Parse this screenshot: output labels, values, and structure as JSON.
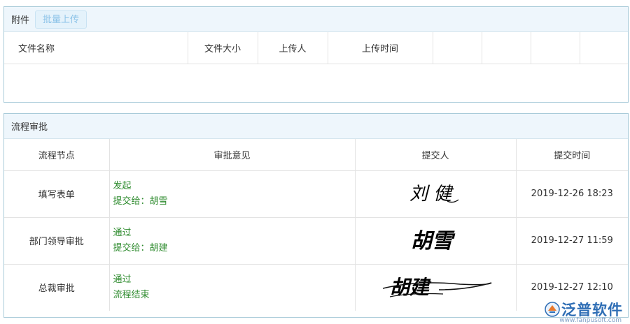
{
  "attachments": {
    "title": "附件",
    "batch_upload_label": "批量上传",
    "columns": [
      "文件名称",
      "文件大小",
      "上传人",
      "上传时间",
      "",
      "",
      "",
      ""
    ]
  },
  "flow": {
    "title": "流程审批",
    "columns": [
      "流程节点",
      "审批意见",
      "提交人",
      "提交时间"
    ],
    "rows": [
      {
        "node": "填写表单",
        "opinion_1": "发起",
        "opinion_2": "提交给：胡雪",
        "signature": "刘 健",
        "time": "2019-12-26 18:23"
      },
      {
        "node": "部门领导审批",
        "opinion_1": "通过",
        "opinion_2": "提交给：胡建",
        "signature": "胡雪",
        "time": "2019-12-27 11:59"
      },
      {
        "node": "总裁审批",
        "opinion_1": "通过",
        "opinion_2": "流程结束",
        "signature": "胡建",
        "time": "2019-12-27 12:10"
      }
    ]
  },
  "watermark": {
    "brand": "泛普软件",
    "url": "www.fanpusoft.com"
  }
}
